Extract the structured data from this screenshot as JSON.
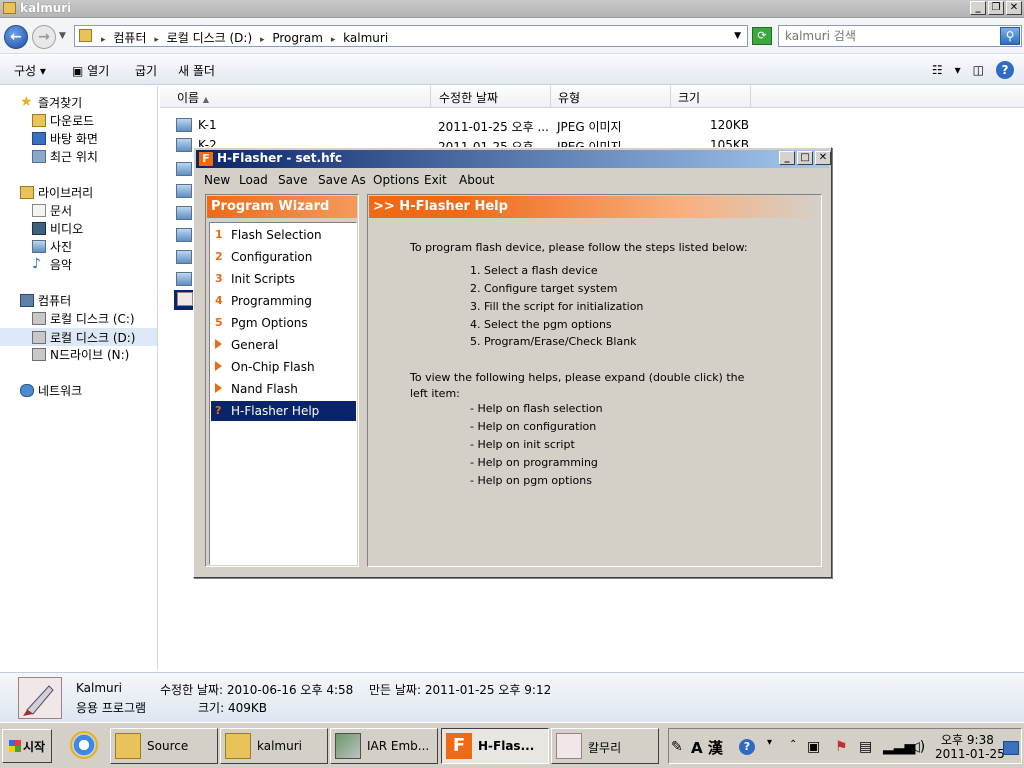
{
  "explorer": {
    "title": "kalmuri",
    "breadcrumbs": [
      "컴퓨터",
      "로컬 디스크 (D:)",
      "Program",
      "kalmuri"
    ],
    "search_placeholder": "kalmuri 검색",
    "commands": {
      "organize": "구성",
      "open": "열기",
      "burn": "굽기",
      "new_folder": "새 폴더"
    },
    "nav": {
      "favorites": "즐겨찾기",
      "downloads": "다운로드",
      "desktop": "바탕 화면",
      "recent": "최근 위치",
      "libraries": "라이브러리",
      "documents": "문서",
      "video": "비디오",
      "pictures": "사진",
      "music": "음악",
      "computer": "컴퓨터",
      "drive_c": "로컬 디스크 (C:)",
      "drive_d": "로컬 디스크 (D:)",
      "drive_n": "N드라이브 (N:)",
      "network": "네트워크"
    },
    "columns": {
      "name": "이름",
      "modified": "수정한 날짜",
      "type": "유형",
      "size": "크기"
    },
    "files": [
      {
        "name": "K-1",
        "modified": "2011-01-25 오후 ...",
        "type": "JPEG 이미지",
        "size": "120KB"
      },
      {
        "name": "K-2",
        "modified": "2011-01-25 오후 ...",
        "type": "JPEG 이미지",
        "size": "105KB"
      }
    ],
    "details": {
      "name": "Kalmuri",
      "type": "응용 프로그램",
      "modified": "수정한 날짜: 2010-06-16 오후 4:58",
      "created": "만든 날짜: 2011-01-25 오후 9:12",
      "size": "크기: 409KB"
    }
  },
  "hflasher": {
    "title": "H-Flasher - set.hfc",
    "menu": [
      "New",
      "Load",
      "Save",
      "Save As",
      "Options",
      "Exit",
      "About"
    ],
    "wizard_title": "Program Wizard",
    "tree": [
      {
        "marker": "1",
        "label": "Flash Selection"
      },
      {
        "marker": "2",
        "label": "Configuration"
      },
      {
        "marker": "3",
        "label": "Init Scripts"
      },
      {
        "marker": "4",
        "label": "Programming"
      },
      {
        "marker": "5",
        "label": "Pgm Options"
      },
      {
        "marker": "",
        "label": "General"
      },
      {
        "marker": "",
        "label": "On-Chip Flash"
      },
      {
        "marker": "",
        "label": "Nand Flash"
      },
      {
        "marker": "?",
        "label": "H-Flasher Help"
      }
    ],
    "help_title": ">> H-Flasher Help",
    "help": {
      "intro": "To program flash device, please follow the steps listed below:",
      "steps": [
        "1. Select a flash device",
        "2. Configure target system",
        "3. Fill the script for initialization",
        "4. Select the pgm options",
        "5. Program/Erase/Check Blank"
      ],
      "expand_line1": "To view the following helps, please expand (double click) the",
      "expand_line2": "left item:",
      "topics": [
        "- Help on flash selection",
        "- Help on configuration",
        "- Help on init script",
        "- Help on programming",
        "- Help on pgm options"
      ]
    }
  },
  "taskbar": {
    "start": "시작",
    "tasks": [
      "Source",
      "kalmuri",
      "IAR Emb...",
      "H-Flas...",
      "칼무리"
    ],
    "tray_ime": "A 漢",
    "time": "오후 9:38",
    "date": "2011-01-25"
  }
}
